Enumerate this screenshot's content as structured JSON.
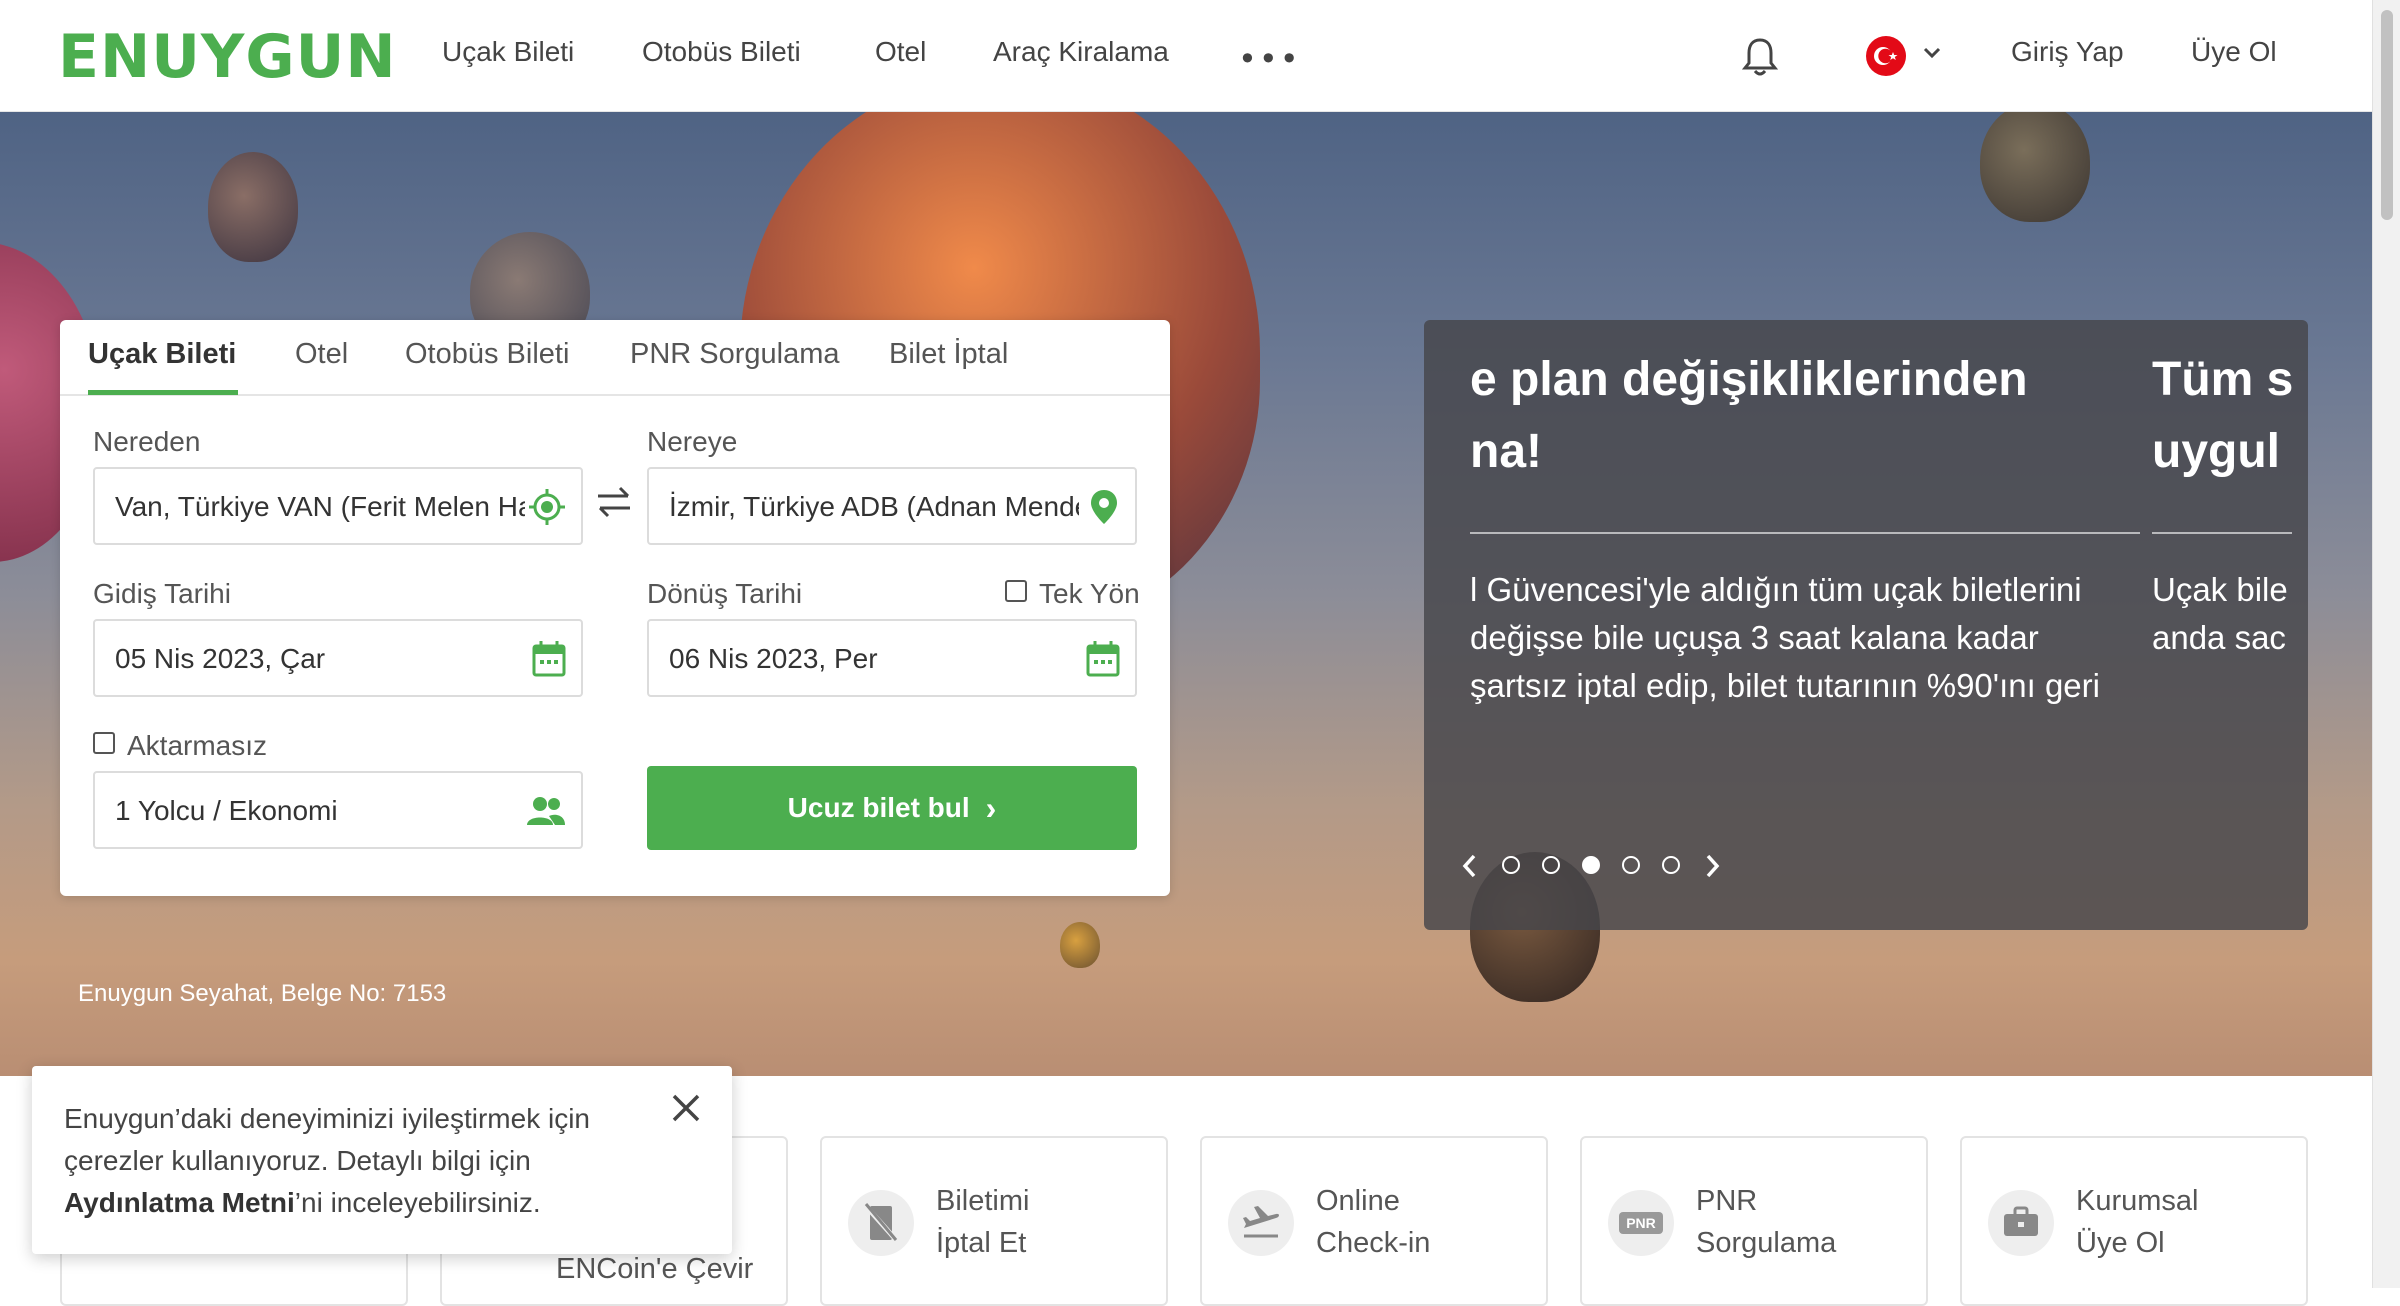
{
  "brand": {
    "logo": "ENUYGUN",
    "accent": "#4cae4f"
  },
  "header": {
    "nav": [
      "Uçak Bileti",
      "Otobüs Bileti",
      "Otel",
      "Araç Kiralama"
    ],
    "more": "•••",
    "login": "Giriş Yap",
    "signup": "Üye Ol",
    "icons": [
      "bell-icon",
      "flag-tr-icon",
      "chevron-down-icon"
    ]
  },
  "search": {
    "tabs": [
      "Uçak Bileti",
      "Otel",
      "Otobüs Bileti",
      "PNR Sorgulama",
      "Bilet İptal"
    ],
    "active_tab": "Uçak Bileti",
    "from_label": "Nereden",
    "from_value": "Van, Türkiye VAN (Ferit Melen Hava",
    "to_label": "Nereye",
    "to_value": "İzmir, Türkiye ADB (Adnan Menderes",
    "depart_label": "Gidiş Tarihi",
    "depart_value": "05 Nis 2023, Çar",
    "return_label": "Dönüş Tarihi",
    "return_value": "06 Nis 2023, Per",
    "oneway_label": "Tek Yön",
    "direct_label": "Aktarmasız",
    "passengers_value": "1 Yolcu / Ekonomi",
    "cta_label": "Ucuz bilet bul",
    "cta_chevron": "›"
  },
  "promo": {
    "slide_a_title": [
      "e plan değişikliklerinden",
      "na!"
    ],
    "slide_a_text": [
      "l Güvencesi'yle aldığın tüm uçak biletlerini",
      " değişse bile uçuşa 3 saat kalana kadar",
      "şartsız iptal edip, bilet tutarının %90'ını geri"
    ],
    "slide_b_title": [
      "Tüm s",
      "uygul"
    ],
    "slide_b_text": [
      "Uçak bile",
      "anda sac"
    ],
    "prev": "‹",
    "next": "›",
    "dots_count": 5,
    "active_dot": 3
  },
  "belge": "Enuygun Seyahat, Belge No: 7153",
  "services": [
    {
      "lines": [
        "",
        "ENCoin'e Çevir"
      ],
      "icon": ""
    },
    {
      "lines": [
        "Biletimi",
        "İptal Et"
      ],
      "icon": "ticket-cancel-icon"
    },
    {
      "lines": [
        "Online",
        "Check-in"
      ],
      "icon": "plane-takeoff-icon"
    },
    {
      "lines": [
        "PNR",
        "Sorgulama"
      ],
      "icon": "pnr-icon"
    },
    {
      "lines": [
        "Kurumsal",
        "Üye Ol"
      ],
      "icon": "briefcase-icon"
    }
  ],
  "pnr_badge": "PNR",
  "cookie": {
    "line1": "Enuygun’daki deneyiminizi iyileştirmek için",
    "line2": "çerezler kullanıyoruz. Detaylı bilgi için",
    "link": "Aydınlatma Metni",
    "rest": "’ni inceleyebilirsiniz."
  }
}
